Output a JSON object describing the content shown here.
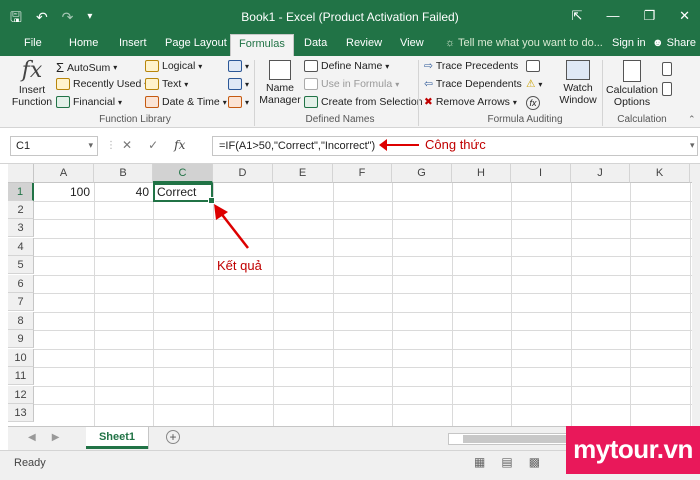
{
  "window": {
    "title": "Book1 - Excel (Product Activation Failed)",
    "qat_icons": [
      "save-icon",
      "undo-icon",
      "redo-icon",
      "customize-icon"
    ],
    "controls": [
      "ribbon-options-icon",
      "minimize-icon",
      "restore-icon",
      "close-icon"
    ]
  },
  "tabs": {
    "items": [
      "File",
      "Home",
      "Insert",
      "Page Layout",
      "Formulas",
      "Data",
      "Review",
      "View"
    ],
    "active": "Formulas",
    "tell_me": "Tell me what you want to do...",
    "sign_in": "Sign in",
    "share": "Share"
  },
  "ribbon": {
    "insert_function": "Insert\nFunction",
    "autosum": "AutoSum",
    "recently_used": "Recently Used",
    "financial": "Financial",
    "logical": "Logical",
    "text": "Text",
    "date_time": "Date & Time",
    "function_library": "Function Library",
    "name_manager": "Name\nManager",
    "define_name": "Define Name",
    "use_in_formula": "Use in Formula",
    "create_from_selection": "Create from Selection",
    "defined_names": "Defined Names",
    "trace_precedents": "Trace Precedents",
    "trace_dependents": "Trace Dependents",
    "remove_arrows": "Remove Arrows",
    "watch_window": "Watch\nWindow",
    "formula_auditing": "Formula Auditing",
    "calculation_options": "Calculation\nOptions",
    "calculation": "Calculation"
  },
  "formula_bar": {
    "name_box": "C1",
    "formula": "=IF(A1>50,\"Correct\",\"Incorrect\")",
    "annotation": "Công thức"
  },
  "grid": {
    "columns": [
      "A",
      "B",
      "C",
      "D",
      "E",
      "F",
      "G",
      "H",
      "I",
      "J",
      "K"
    ],
    "rows": [
      "1",
      "2",
      "3",
      "4",
      "5",
      "6",
      "7",
      "8",
      "9",
      "10",
      "11",
      "12",
      "13"
    ],
    "cells": {
      "A1": "100",
      "B1": "40",
      "C1": "Correct"
    },
    "selected_cell": "C1",
    "annotation": "Kết quả"
  },
  "sheets": {
    "tabs": [
      "Sheet1"
    ],
    "active": "Sheet1"
  },
  "status": {
    "text": "Ready"
  },
  "brand": {
    "text": "mytour.vn"
  }
}
